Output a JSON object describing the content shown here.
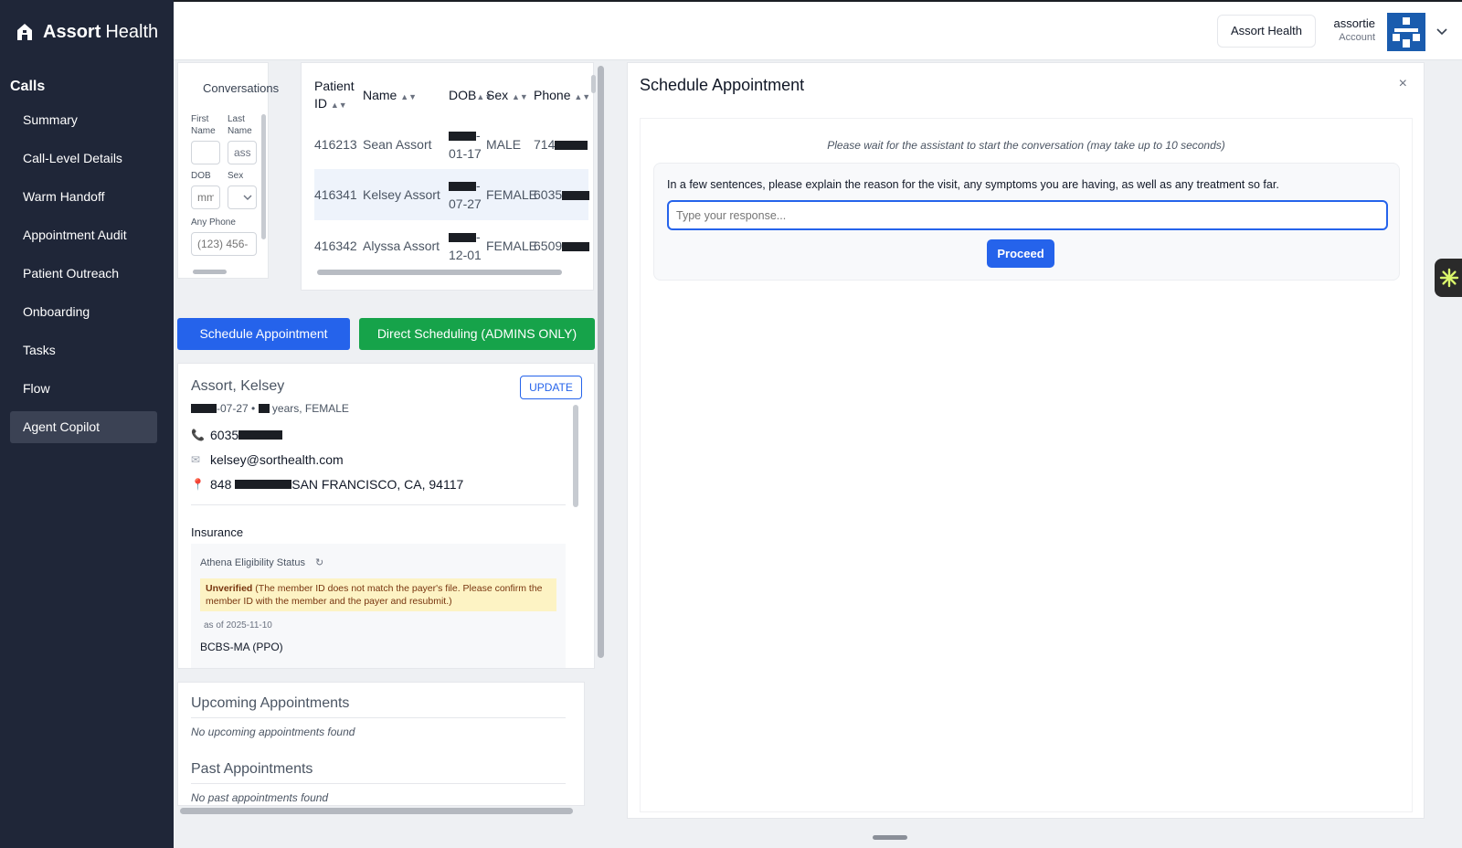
{
  "brand": {
    "name_bold": "Assort",
    "name_rest": "Health"
  },
  "sidebar": {
    "heading": "Calls",
    "items": [
      {
        "label": "Summary"
      },
      {
        "label": "Call-Level Details"
      },
      {
        "label": "Warm Handoff"
      },
      {
        "label": "Appointment Audit"
      },
      {
        "label": "Patient Outreach"
      },
      {
        "label": "Onboarding"
      },
      {
        "label": "Tasks"
      },
      {
        "label": "Flow"
      },
      {
        "label": "Agent Copilot",
        "active": true
      }
    ]
  },
  "header": {
    "org_button": "Assort Health",
    "user_name": "assortie",
    "user_role": "Account"
  },
  "filters": {
    "title": "Conversations",
    "first_name_label": "First Name",
    "last_name_label": "Last Name",
    "last_name_value": "ass",
    "dob_label": "DOB",
    "dob_placeholder": "mm",
    "sex_label": "Sex",
    "phone_label": "Any Phone",
    "phone_placeholder": "(123) 456-"
  },
  "table": {
    "headers": [
      "Patient ID",
      "Name",
      "DOB",
      "Sex",
      "Phone"
    ],
    "rows": [
      {
        "id": "416213",
        "name": "Sean Assort",
        "dob_suffix": "01-17",
        "sex": "MALE",
        "phone_prefix": "714"
      },
      {
        "id": "416341",
        "name": "Kelsey Assort",
        "dob_suffix": "07-27",
        "sex": "FEMALE",
        "phone_prefix": "6035",
        "selected": true
      },
      {
        "id": "416342",
        "name": "Alyssa Assort",
        "dob_suffix": "12-01",
        "sex": "FEMALE",
        "phone_prefix": "6509"
      }
    ]
  },
  "actions": {
    "schedule": "Schedule Appointment",
    "direct": "Direct Scheduling (ADMINS ONLY)"
  },
  "patient": {
    "name": "Assort, Kelsey",
    "update_label": "UPDATE",
    "dob_suffix": "-07-27",
    "age_sex": "years, FEMALE",
    "phone_prefix": "6035",
    "email": "kelsey@sorthealth.com",
    "address_prefix": "848",
    "address_city": "SAN FRANCISCO, CA, 94117",
    "insurance_label": "Insurance",
    "eligibility_label": "Athena Eligibility Status",
    "status": "Unverified",
    "status_note": "(The member ID does not match the payer's file. Please confirm the member ID with the member and the payer and resubmit.)",
    "as_of": "as of 2025-11-10",
    "plan": "BCBS-MA (PPO)"
  },
  "appointments": {
    "upcoming_title": "Upcoming Appointments",
    "upcoming_empty": "No upcoming appointments found",
    "past_title": "Past Appointments",
    "past_empty": "No past appointments found"
  },
  "modal": {
    "title": "Schedule Appointment",
    "close": "×",
    "wait_text": "Please wait for the assistant to start the conversation (may take up to 10 seconds)",
    "question": "In a few sentences, please explain the reason for the visit, any symptoms you are having, as well as any treatment so far.",
    "response_placeholder": "Type your response...",
    "proceed": "Proceed"
  },
  "colors": {
    "sidebar_bg": "#1f2638",
    "primary": "#2563eb",
    "success": "#16a34a",
    "warning_bg": "#fdf3c4"
  }
}
